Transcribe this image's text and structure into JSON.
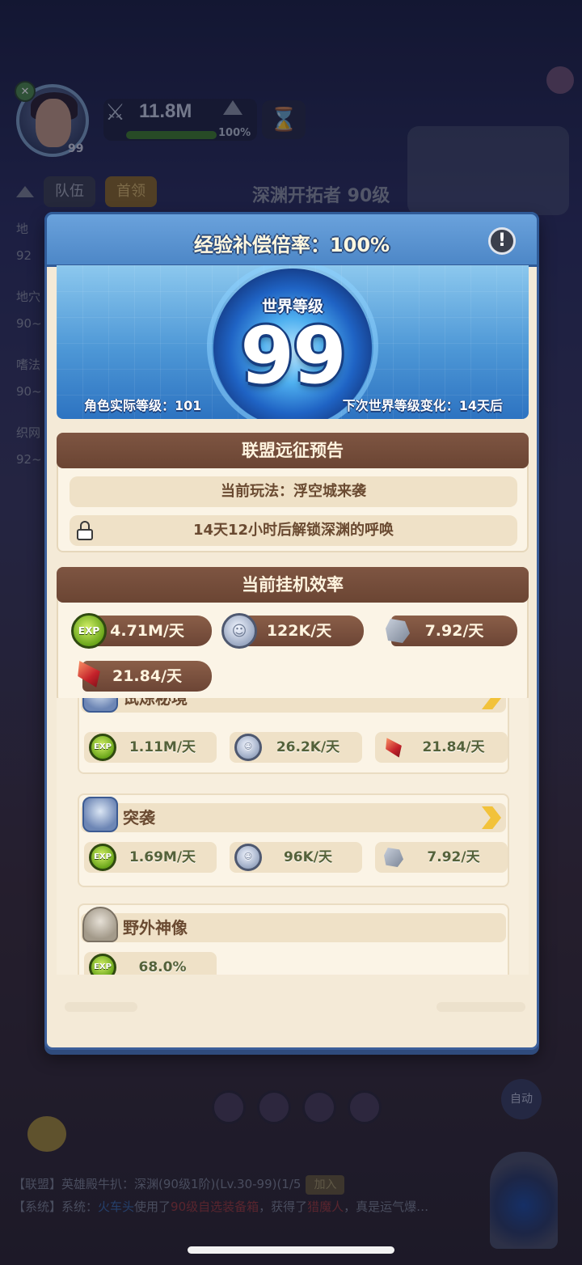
{
  "hud": {
    "player_level": "99",
    "alliance_badge": "✕",
    "power": "11.8M",
    "power_progress": "100%",
    "tabs": [
      "队伍",
      "首领"
    ],
    "stage": "深渊开拓者 90级",
    "side_items": [
      "地",
      "92",
      "地穴",
      "90~",
      "嗜法",
      "90~",
      "织网",
      "92~"
    ],
    "auto_label": "自动",
    "chat": {
      "line1_prefix": "【联盟】英雄殿牛扒：深渊(90级1阶)(Lv.30-99)(1/5",
      "join_label": "加入",
      "line2_prefix": "【系统】系统：",
      "line2_name": "火车头",
      "line2_mid": "使用了",
      "line2_item": "90级自选装备箱",
      "line2_mid2": "，获得了",
      "line2_reward": "猎魔人",
      "line2_tail": "，真是运气爆…"
    }
  },
  "modal": {
    "title": "经验补偿倍率：100%",
    "info_icon": "!",
    "world": {
      "label": "世界等级",
      "level": "99",
      "actual_level": "角色实际等级：101",
      "next_change": "下次世界等级变化：14天后"
    },
    "alliance": {
      "heading": "联盟远征预告",
      "current": "当前玩法：浮空城来袭",
      "unlock": "14天12小时后解锁深渊的呼唤"
    },
    "efficiency": {
      "heading": "当前挂机效率",
      "rates": [
        {
          "icon": "exp-icon",
          "icon_text": "EXP",
          "value": "4.71M/天"
        },
        {
          "icon": "coin-icon",
          "icon_text": "",
          "value": "122K/天"
        },
        {
          "icon": "stone-icon",
          "icon_text": "",
          "value": "7.92/天"
        },
        {
          "icon": "gem-icon",
          "icon_text": "",
          "value": "21.84/天"
        }
      ]
    },
    "sources": [
      {
        "name": "试炼秘境",
        "rates": [
          {
            "icon": "exp-icon",
            "icon_text": "EXP",
            "value": "1.11M/天"
          },
          {
            "icon": "coin-icon",
            "icon_text": "",
            "value": "26.2K/天"
          },
          {
            "icon": "gem-icon",
            "icon_text": "",
            "value": "21.84/天"
          }
        ]
      },
      {
        "name": "突袭",
        "rates": [
          {
            "icon": "exp-icon",
            "icon_text": "EXP",
            "value": "1.69M/天"
          },
          {
            "icon": "coin-icon",
            "icon_text": "",
            "value": "96K/天"
          },
          {
            "icon": "stone-icon",
            "icon_text": "",
            "value": "7.92/天"
          }
        ]
      },
      {
        "name": "野外神像",
        "rates": [
          {
            "icon": "exp-icon",
            "icon_text": "EXP",
            "value": "68.0%"
          }
        ]
      }
    ]
  },
  "colors": {
    "header_blue": "#4d87c7",
    "section_brown": "#6b4533",
    "panel_cream": "#f4ead7",
    "accent_gold": "#f2c23a"
  }
}
